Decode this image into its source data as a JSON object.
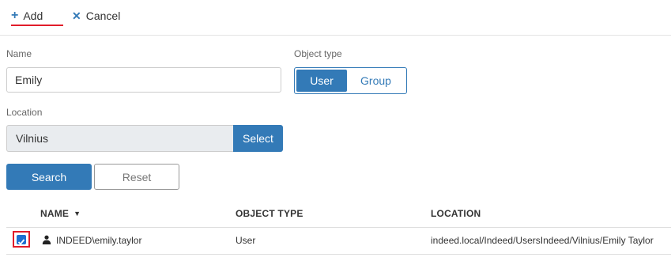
{
  "toolbar": {
    "add_label": "Add",
    "cancel_label": "Cancel"
  },
  "form": {
    "name_label": "Name",
    "name_value": "Emily",
    "object_type_label": "Object type",
    "object_type_options": [
      "User",
      "Group"
    ],
    "object_type_selected": "User",
    "location_label": "Location",
    "location_value": "Vilnius",
    "select_label": "Select",
    "search_label": "Search",
    "reset_label": "Reset"
  },
  "table": {
    "columns": [
      "NAME",
      "OBJECT TYPE",
      "LOCATION"
    ],
    "sort_column": "NAME",
    "rows": [
      {
        "checked": true,
        "name": "INDEED\\emily.taylor",
        "object_type": "User",
        "location": "indeed.local/Indeed/UsersIndeed/Vilnius/Emily Taylor"
      }
    ]
  },
  "colors": {
    "accent": "#337ab7",
    "highlight": "#e11d2a",
    "checkbox": "#1e6fd0"
  }
}
